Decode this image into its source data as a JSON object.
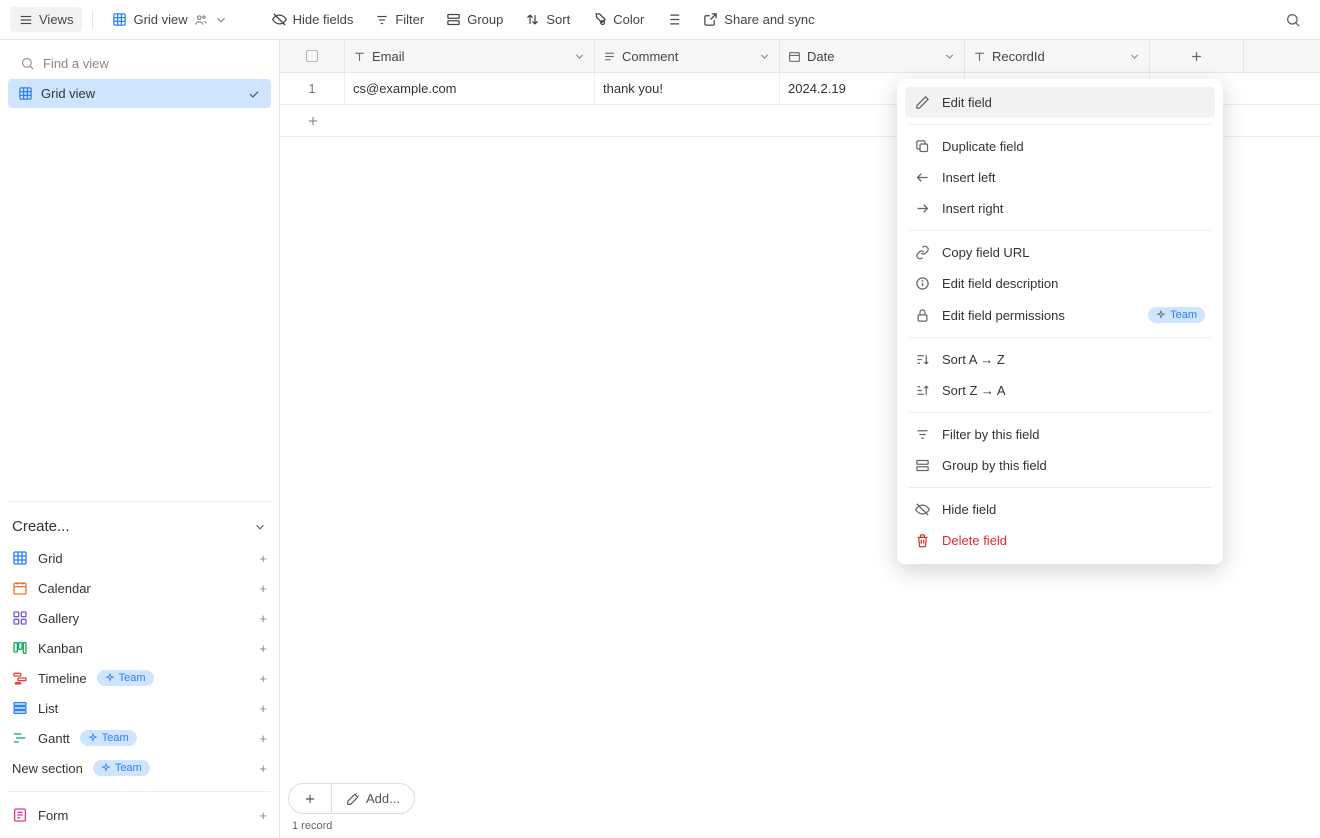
{
  "toolbar": {
    "views": "Views",
    "grid_view": "Grid view",
    "hide_fields": "Hide fields",
    "filter": "Filter",
    "group": "Group",
    "sort": "Sort",
    "color": "Color",
    "share": "Share and sync"
  },
  "sidebar": {
    "search_placeholder": "Find a view",
    "view_list": [
      {
        "label": "Grid view"
      }
    ],
    "create_heading": "Create...",
    "create_items": [
      {
        "label": "Grid",
        "color": "#2d7ff9"
      },
      {
        "label": "Calendar",
        "color": "#e67a30"
      },
      {
        "label": "Gallery",
        "color": "#7c58d3"
      },
      {
        "label": "Kanban",
        "color": "#11af5a"
      },
      {
        "label": "Timeline",
        "color": "#e0463b",
        "badge": "Team"
      },
      {
        "label": "List",
        "color": "#2d7ff9"
      },
      {
        "label": "Gantt",
        "color": "#0fa592",
        "badge": "Team"
      }
    ],
    "new_section": "New section",
    "new_section_badge": "Team",
    "form_label": "Form",
    "form_color": "#e03ba0"
  },
  "grid": {
    "columns": [
      {
        "label": "Email",
        "type": "text",
        "primary": true
      },
      {
        "label": "Comment",
        "type": "text"
      },
      {
        "label": "Date",
        "type": "date"
      },
      {
        "label": "RecordId",
        "type": "text"
      }
    ],
    "rows": [
      {
        "num": "1",
        "cells": [
          "cs@example.com",
          "thank you!",
          "2024.2.19",
          ""
        ]
      }
    ],
    "footer_add": "Add...",
    "record_count": "1 record"
  },
  "ctx": {
    "items": [
      {
        "label": "Edit field",
        "icon": "pencil",
        "hover": true
      },
      {
        "sep": true
      },
      {
        "label": "Duplicate field",
        "icon": "copy"
      },
      {
        "label": "Insert left",
        "icon": "arrow-left"
      },
      {
        "label": "Insert right",
        "icon": "arrow-right"
      },
      {
        "sep": true
      },
      {
        "label": "Copy field URL",
        "icon": "link"
      },
      {
        "label": "Edit field description",
        "icon": "info"
      },
      {
        "label": "Edit field permissions",
        "icon": "lock",
        "badge": "Team"
      },
      {
        "sep": true
      },
      {
        "label": "Sort A → Z",
        "icon": "sort-az"
      },
      {
        "label": "Sort Z → A",
        "icon": "sort-za"
      },
      {
        "sep": true
      },
      {
        "label": "Filter by this field",
        "icon": "filter"
      },
      {
        "label": "Group by this field",
        "icon": "group"
      },
      {
        "sep": true
      },
      {
        "label": "Hide field",
        "icon": "eye-off"
      },
      {
        "label": "Delete field",
        "icon": "trash",
        "danger": true
      }
    ]
  }
}
